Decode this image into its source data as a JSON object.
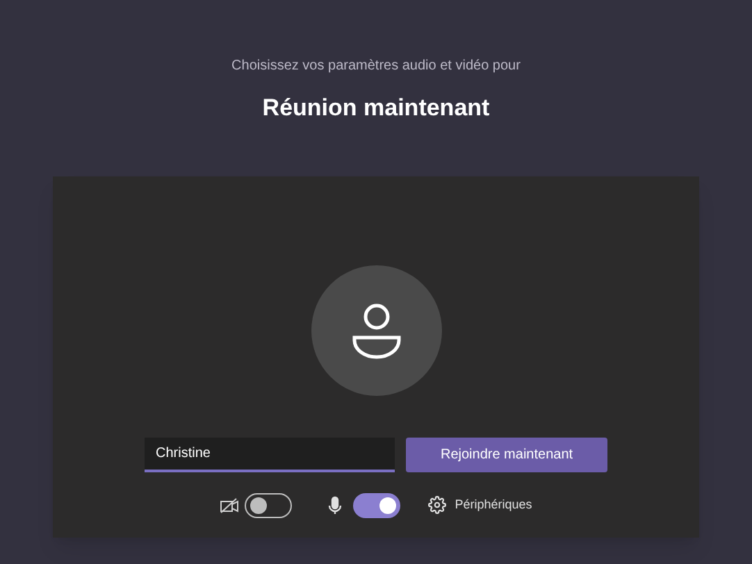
{
  "subtitle": "Choisissez vos paramètres audio et vidéo pour",
  "title": "Réunion maintenant",
  "name_field": {
    "value": "Christine"
  },
  "join_button": "Rejoindre maintenant",
  "camera": {
    "on": false
  },
  "microphone": {
    "on": true
  },
  "devices_button": "Périphériques"
}
